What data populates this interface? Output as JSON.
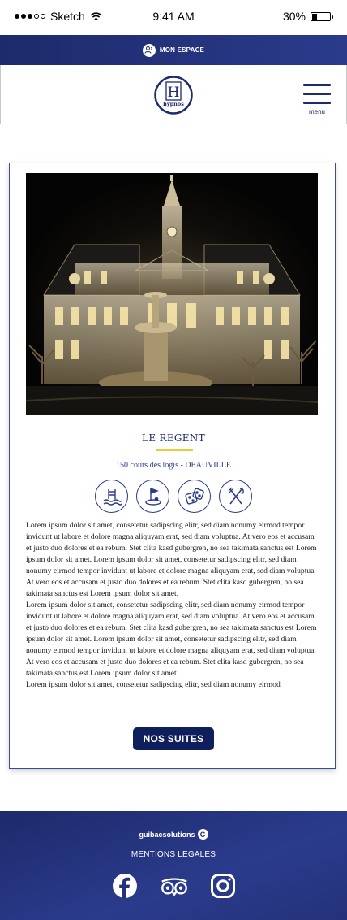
{
  "status_bar": {
    "carrier": "Sketch",
    "time": "9:41 AM",
    "battery": "30%",
    "battery_level": 0.3
  },
  "topbar": {
    "account_label": "MON ESPACE",
    "account_icon": "user-icon"
  },
  "header": {
    "logo_letter": "H",
    "logo_text": "hypnos",
    "menu_label": "menu",
    "menu_icon": "hamburger-icon"
  },
  "hotel": {
    "name": "LE REGENT",
    "address": "150 cours des logis - DEAUVILLE",
    "amenities": [
      "pool-icon",
      "golf-icon",
      "casino-dice-icon",
      "restaurant-icon"
    ],
    "description": [
      "Lorem ipsum dolor sit amet, consetetur sadipscing elitr, sed diam nonumy eirmod tempor invidunt ut labore et dolore magna aliquyam erat, sed diam voluptua. At vero eos et accusam et justo duo dolores et ea rebum. Stet clita kasd gubergren, no sea takimata sanctus est Lorem ipsum dolor sit amet. Lorem ipsum dolor sit amet, consetetur sadipscing elitr, sed diam nonumy eirmod tempor invidunt ut labore et dolore magna aliquyam erat, sed diam voluptua. At vero eos et accusam et justo duo dolores et ea rebum. Stet clita kasd gubergren, no sea takimata sanctus est Lorem ipsum dolor sit amet.",
      "Lorem ipsum dolor sit amet, consetetur sadipscing elitr, sed diam nonumy eirmod tempor invidunt ut labore et dolore magna aliquyam erat, sed diam voluptua. At vero eos et accusam et justo duo dolores et ea rebum. Stet clita kasd gubergren, no sea takimata sanctus est Lorem ipsum dolor sit amet. Lorem ipsum dolor sit amet, consetetur sadipscing elitr, sed diam nonumy eirmod tempor invidunt ut labore et dolore magna aliquyam erat, sed diam voluptua. At vero eos et accusam et justo duo dolores et ea rebum. Stet clita kasd gubergren, no sea takimata sanctus est Lorem ipsum dolor sit amet.",
      "Lorem ipsum dolor sit amet, consetetur sadipscing elitr, sed diam nonumy eirmod"
    ],
    "cta_label": "NOS SUITES"
  },
  "footer": {
    "brand": "guibacsolutions",
    "brand_badge": "C",
    "legal_label": "MENTIONS LEGALES",
    "social": [
      "facebook-icon",
      "tripadvisor-icon",
      "instagram-icon"
    ]
  },
  "colors": {
    "primary": "#1d2a6b",
    "button": "#0f1f5e",
    "accent": "#e4cf3a"
  }
}
